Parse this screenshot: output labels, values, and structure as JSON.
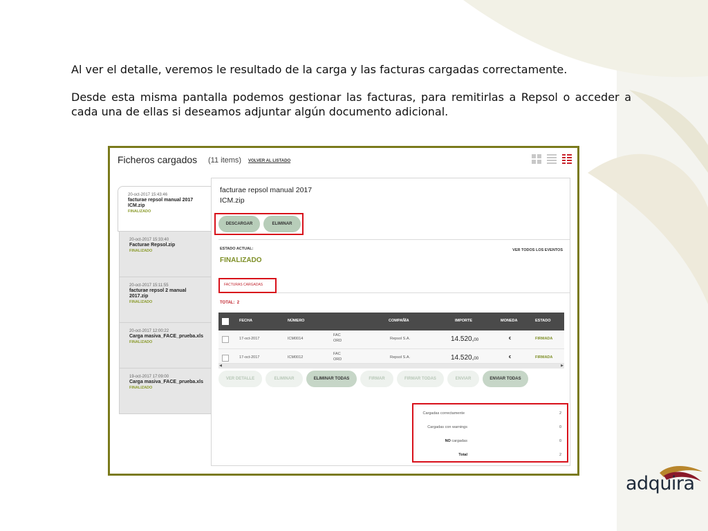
{
  "intro": {
    "line1": "Al ver el detalle, veremos le resultado de la carga y las facturas cargadas correctamente.",
    "line2": "Desde esta misma pantalla podemos gestionar las facturas, para remitirlas a Repsol o acceder a cada una de ellas si deseamos adjuntar algún documento adicional."
  },
  "app": {
    "title": "Ficheros cargados",
    "count": "(11 items)",
    "back_link": "VOLVER AL LISTADO"
  },
  "files": [
    {
      "date": "20-oct-2017 15:43:46",
      "name": "facturae repsol manual 2017 ICM.zip",
      "status": "FINALIZADO"
    },
    {
      "date": "20-oct-2017 15:33:40",
      "name": "Facturae Repsol.zip",
      "status": "FINALIZADO"
    },
    {
      "date": "20-oct-2017 15:11:55",
      "name": "facturae repsol 2 manual 2017.zip",
      "status": "FINALIZADO"
    },
    {
      "date": "20-oct-2017 12:00:22",
      "name": "Carga masiva_FACE_prueba.xls",
      "status": "FINALIZADO"
    },
    {
      "date": "19-oct-2017 17:09:00",
      "name": "Carga masiva_FACE_prueba.xls",
      "status": "FINALIZADO"
    }
  ],
  "detail": {
    "title_line1": "facturae repsol manual 2017",
    "title_line2": "ICM.zip",
    "btn_download": "DESCARGAR",
    "btn_delete": "ELIMINAR",
    "state_label": "ESTADO ACTUAL:",
    "state_value": "FINALIZADO",
    "events_link": "VER TODOS LOS EVENTOS",
    "tab_label": "FACTURAS CARGADAS",
    "total_label": "TOTAL:",
    "total_value": "2"
  },
  "table": {
    "headers": {
      "fecha": "FECHA",
      "numero": "NÚMERO",
      "compania": "COMPAÑÍA",
      "importe": "IMPORTE",
      "moneda": "MONEDA",
      "estado": "ESTADO"
    },
    "rows": [
      {
        "fecha": "17-oct-2017",
        "numero": "ICM0014",
        "tipo1": "FAC",
        "tipo2": "ORD",
        "compania": "Repsol S.A.",
        "importe_int": "14.520,",
        "importe_dec": "00",
        "moneda": "€",
        "estado": "FIRMADA"
      },
      {
        "fecha": "17-oct-2017",
        "numero": "ICM0012",
        "tipo1": "FAC",
        "tipo2": "ORD",
        "compania": "Repsol S.A.",
        "importe_int": "14.520,",
        "importe_dec": "00",
        "moneda": "€",
        "estado": "FIRMADA"
      }
    ]
  },
  "actions": {
    "ver_detalle": "VER DETALLE",
    "eliminar": "ELIMINAR",
    "eliminar_todas": "ELIMINAR TODAS",
    "firmar": "FIRMAR",
    "firmar_todas": "FIRMAR TODAS",
    "enviar": "ENVIAR",
    "enviar_todas": "ENVIAR TODAS"
  },
  "summary": {
    "ok_label": "Cargadas correctamente",
    "ok_value": "2",
    "warn_label": "Cargadas con warnings",
    "warn_value": "0",
    "no_label_bold": "NO",
    "no_label_rest": "cargadas",
    "no_value": "0",
    "total_label": "Total",
    "total_value": "2"
  },
  "brand": {
    "logo_text": "adquira"
  },
  "colors": {
    "frame_border": "#7a7a1c",
    "highlight": "#d8101a",
    "status_green": "#7e8f27",
    "button_green": "#b7cdb9"
  }
}
